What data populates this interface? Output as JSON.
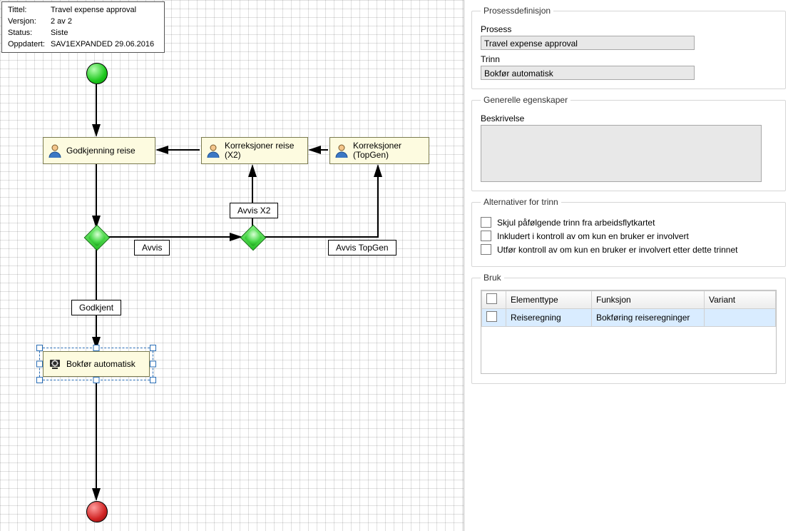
{
  "info": {
    "title_label": "Tittel:",
    "title": "Travel expense approval",
    "version_label": "Versjon:",
    "version": "2 av 2",
    "status_label": "Status:",
    "status": "Siste",
    "updated_label": "Oppdatert:",
    "updated": "SAV1EXPANDED  29.06.2016"
  },
  "nodes": {
    "godkjenning": "Godkjenning reise",
    "korr_x2_l1": "Korreksjoner reise",
    "korr_x2_l2": "(X2)",
    "korr_tg_l1": "Korreksjoner",
    "korr_tg_l2": "(TopGen)",
    "bokfor": "Bokfør automatisk"
  },
  "tags": {
    "avvis_x2": "Avvis X2",
    "avvis": "Avvis",
    "avvis_topgen": "Avvis TopGen",
    "godkjent": "Godkjent"
  },
  "panel": {
    "sec_process": "Prosessdefinisjon",
    "lbl_process": "Prosess",
    "val_process": "Travel expense approval",
    "lbl_step": "Trinn",
    "val_step": "Bokfør automatisk",
    "sec_general": "Generelle egenskaper",
    "lbl_desc": "Beskrivelse",
    "sec_alt": "Alternativer for trinn",
    "opt_hide": "Skjul påfølgende trinn fra arbeidsflytkartet",
    "opt_included": "Inkludert i kontroll av om kun en bruker er involvert",
    "opt_after": "Utfør kontroll av om kun en bruker er involvert etter dette trinnet",
    "sec_bruk": "Bruk",
    "col_type": "Elementtype",
    "col_func": "Funksjon",
    "col_variant": "Variant",
    "row_type": "Reiseregning",
    "row_func": "Bokføring reiseregninger",
    "row_variant": ""
  }
}
